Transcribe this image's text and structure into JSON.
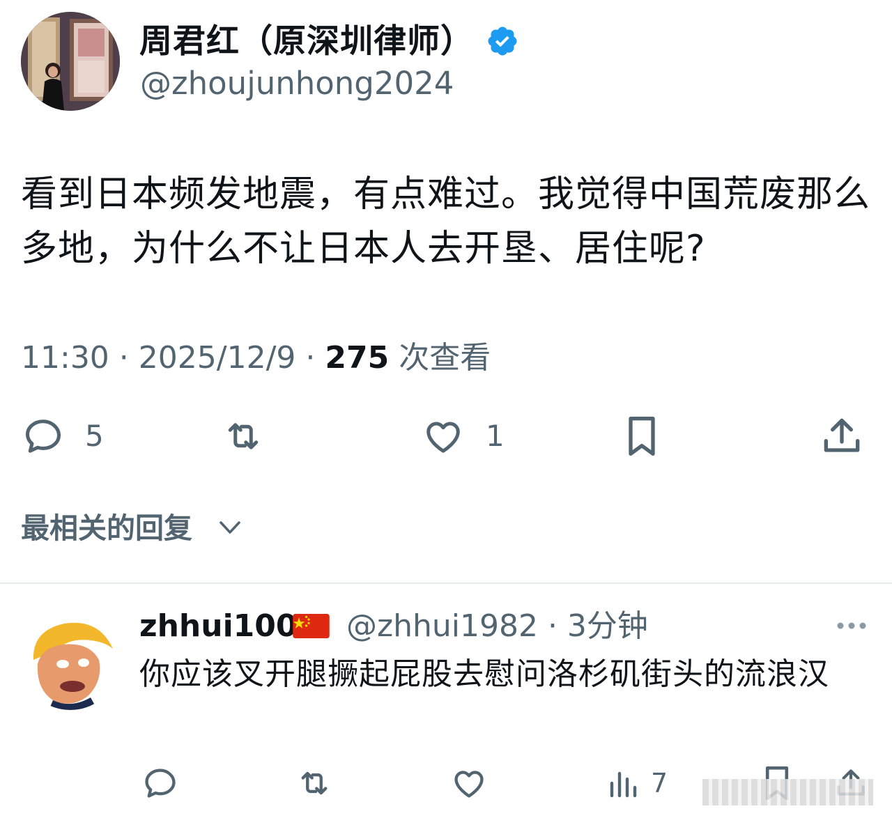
{
  "tweet": {
    "author_name": "周君红（原深圳律师）",
    "author_handle": "@zhoujunhong2024",
    "text": "看到日本频发地震，有点难过。我觉得中国荒废那么多地，为什么不让日本人去开垦、居住呢?",
    "time": "11:30",
    "date": "2025/12/9",
    "views_count": "275",
    "views_label": "次查看",
    "separator": " · ",
    "reply_count": "5",
    "like_count": "1"
  },
  "replies_sort": {
    "label": "最相关的回复"
  },
  "reply": {
    "name": "zhhui100",
    "handle_time": "@zhhui1982 · 3分钟",
    "text": "你应该叉开腿撅起屁股去慰问洛杉矶街头的流浪汉",
    "views_count": "7"
  },
  "colors": {
    "text_primary": "#0f1419",
    "text_secondary": "#536471",
    "verified_blue": "#1d9bf0",
    "divider": "#e6ebee"
  },
  "icons": [
    "verified-badge-icon",
    "reply-icon",
    "retweet-icon",
    "like-icon",
    "bookmark-icon",
    "share-icon",
    "chevron-down-icon",
    "more-icon",
    "views-icon",
    "china-flag-icon"
  ]
}
